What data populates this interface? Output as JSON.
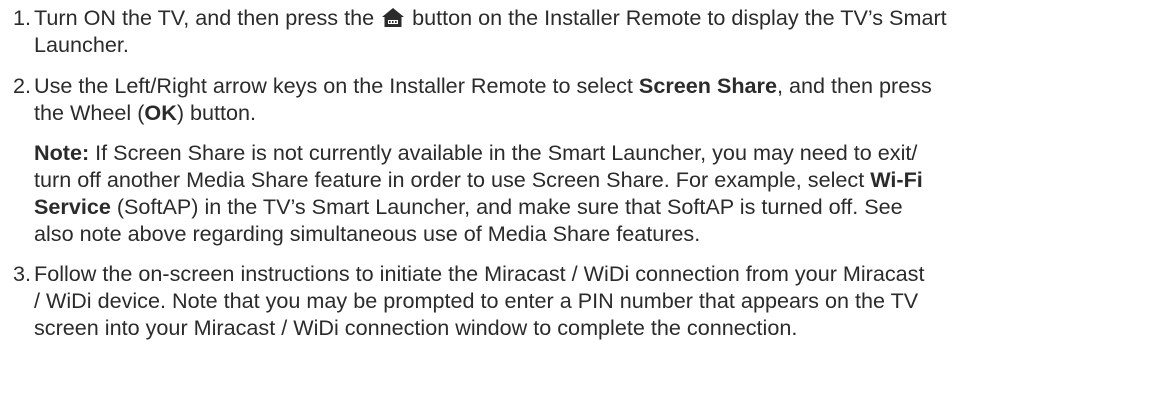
{
  "steps": [
    {
      "number": "1.",
      "line1_a": "Turn ON the TV, and then press the",
      "icon": "home-icon",
      "line1_b": "button on the Installer Remote to display the TV’s Smart",
      "line2": "Launcher."
    },
    {
      "number": "2.",
      "line1_a": "Use the Left/Right arrow keys on the Installer Remote to select ",
      "line1_bold": "Screen Share",
      "line1_b": ", and then press",
      "line2_a": "the Wheel (",
      "line2_bold": "OK",
      "line2_b": ") button.",
      "note_label": "Note:",
      "note_line1": " If Screen Share is not currently available in the Smart Launcher, you may need to exit/",
      "note_line2_a": "turn off another Media Share feature in order to use Screen Share. For example, select ",
      "note_line2_bold": "Wi-Fi",
      "note_line3_bold": "Service",
      "note_line3_b": " (SoftAP) in the TV’s Smart Launcher, and make sure that SoftAP is turned off. See",
      "note_line4": "also note above regarding simultaneous use of Media Share features."
    },
    {
      "number": "3.",
      "line1": "Follow the on-screen instructions to initiate the Miracast / WiDi connection from your Miracast",
      "line2": "/ WiDi device. Note that you may be prompted to enter a PIN number that appears on the TV",
      "line3": "screen into your Miracast / WiDi connection window to complete the connection."
    }
  ]
}
